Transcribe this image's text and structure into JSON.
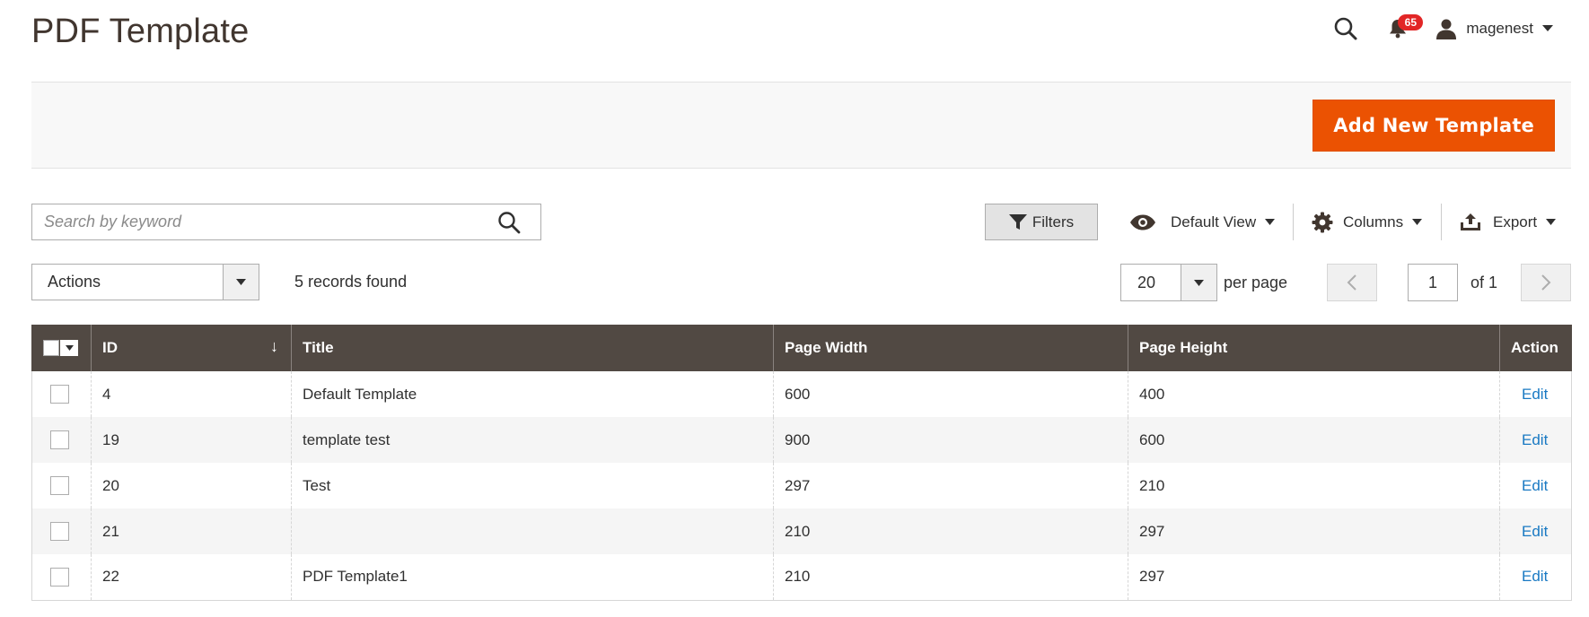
{
  "page": {
    "title": "PDF Template"
  },
  "header": {
    "notifications_count": "65",
    "username": "magenest",
    "icons": [
      "search-icon",
      "bell-icon",
      "user-icon",
      "caret-down-icon"
    ]
  },
  "action_bar": {
    "add_button_label": "Add New Template"
  },
  "toolbar": {
    "search_placeholder": "Search by keyword",
    "filters_label": "Filters",
    "view_label": "Default View",
    "columns_label": "Columns",
    "export_label": "Export"
  },
  "mass_actions": {
    "selected": "Actions",
    "records_text": "5 records found"
  },
  "pagination": {
    "per_page_value": "20",
    "per_page_label": "per page",
    "current_page": "1",
    "of_label": "of 1"
  },
  "grid": {
    "columns": [
      "ID",
      "Title",
      "Page Width",
      "Page Height",
      "Action"
    ],
    "sort_indicator": "↓",
    "rows": [
      {
        "id": "4",
        "title": "Default Template",
        "width": "600",
        "height": "400",
        "action": "Edit"
      },
      {
        "id": "19",
        "title": "template test",
        "width": "900",
        "height": "600",
        "action": "Edit"
      },
      {
        "id": "20",
        "title": "Test",
        "width": "297",
        "height": "210",
        "action": "Edit"
      },
      {
        "id": "21",
        "title": "",
        "width": "210",
        "height": "297",
        "action": "Edit"
      },
      {
        "id": "22",
        "title": "PDF Template1",
        "width": "210",
        "height": "297",
        "action": "Edit"
      }
    ]
  },
  "colors": {
    "accent": "#eb5202",
    "grid_header": "#514943",
    "link": "#1979c3",
    "badge": "#e22626"
  }
}
